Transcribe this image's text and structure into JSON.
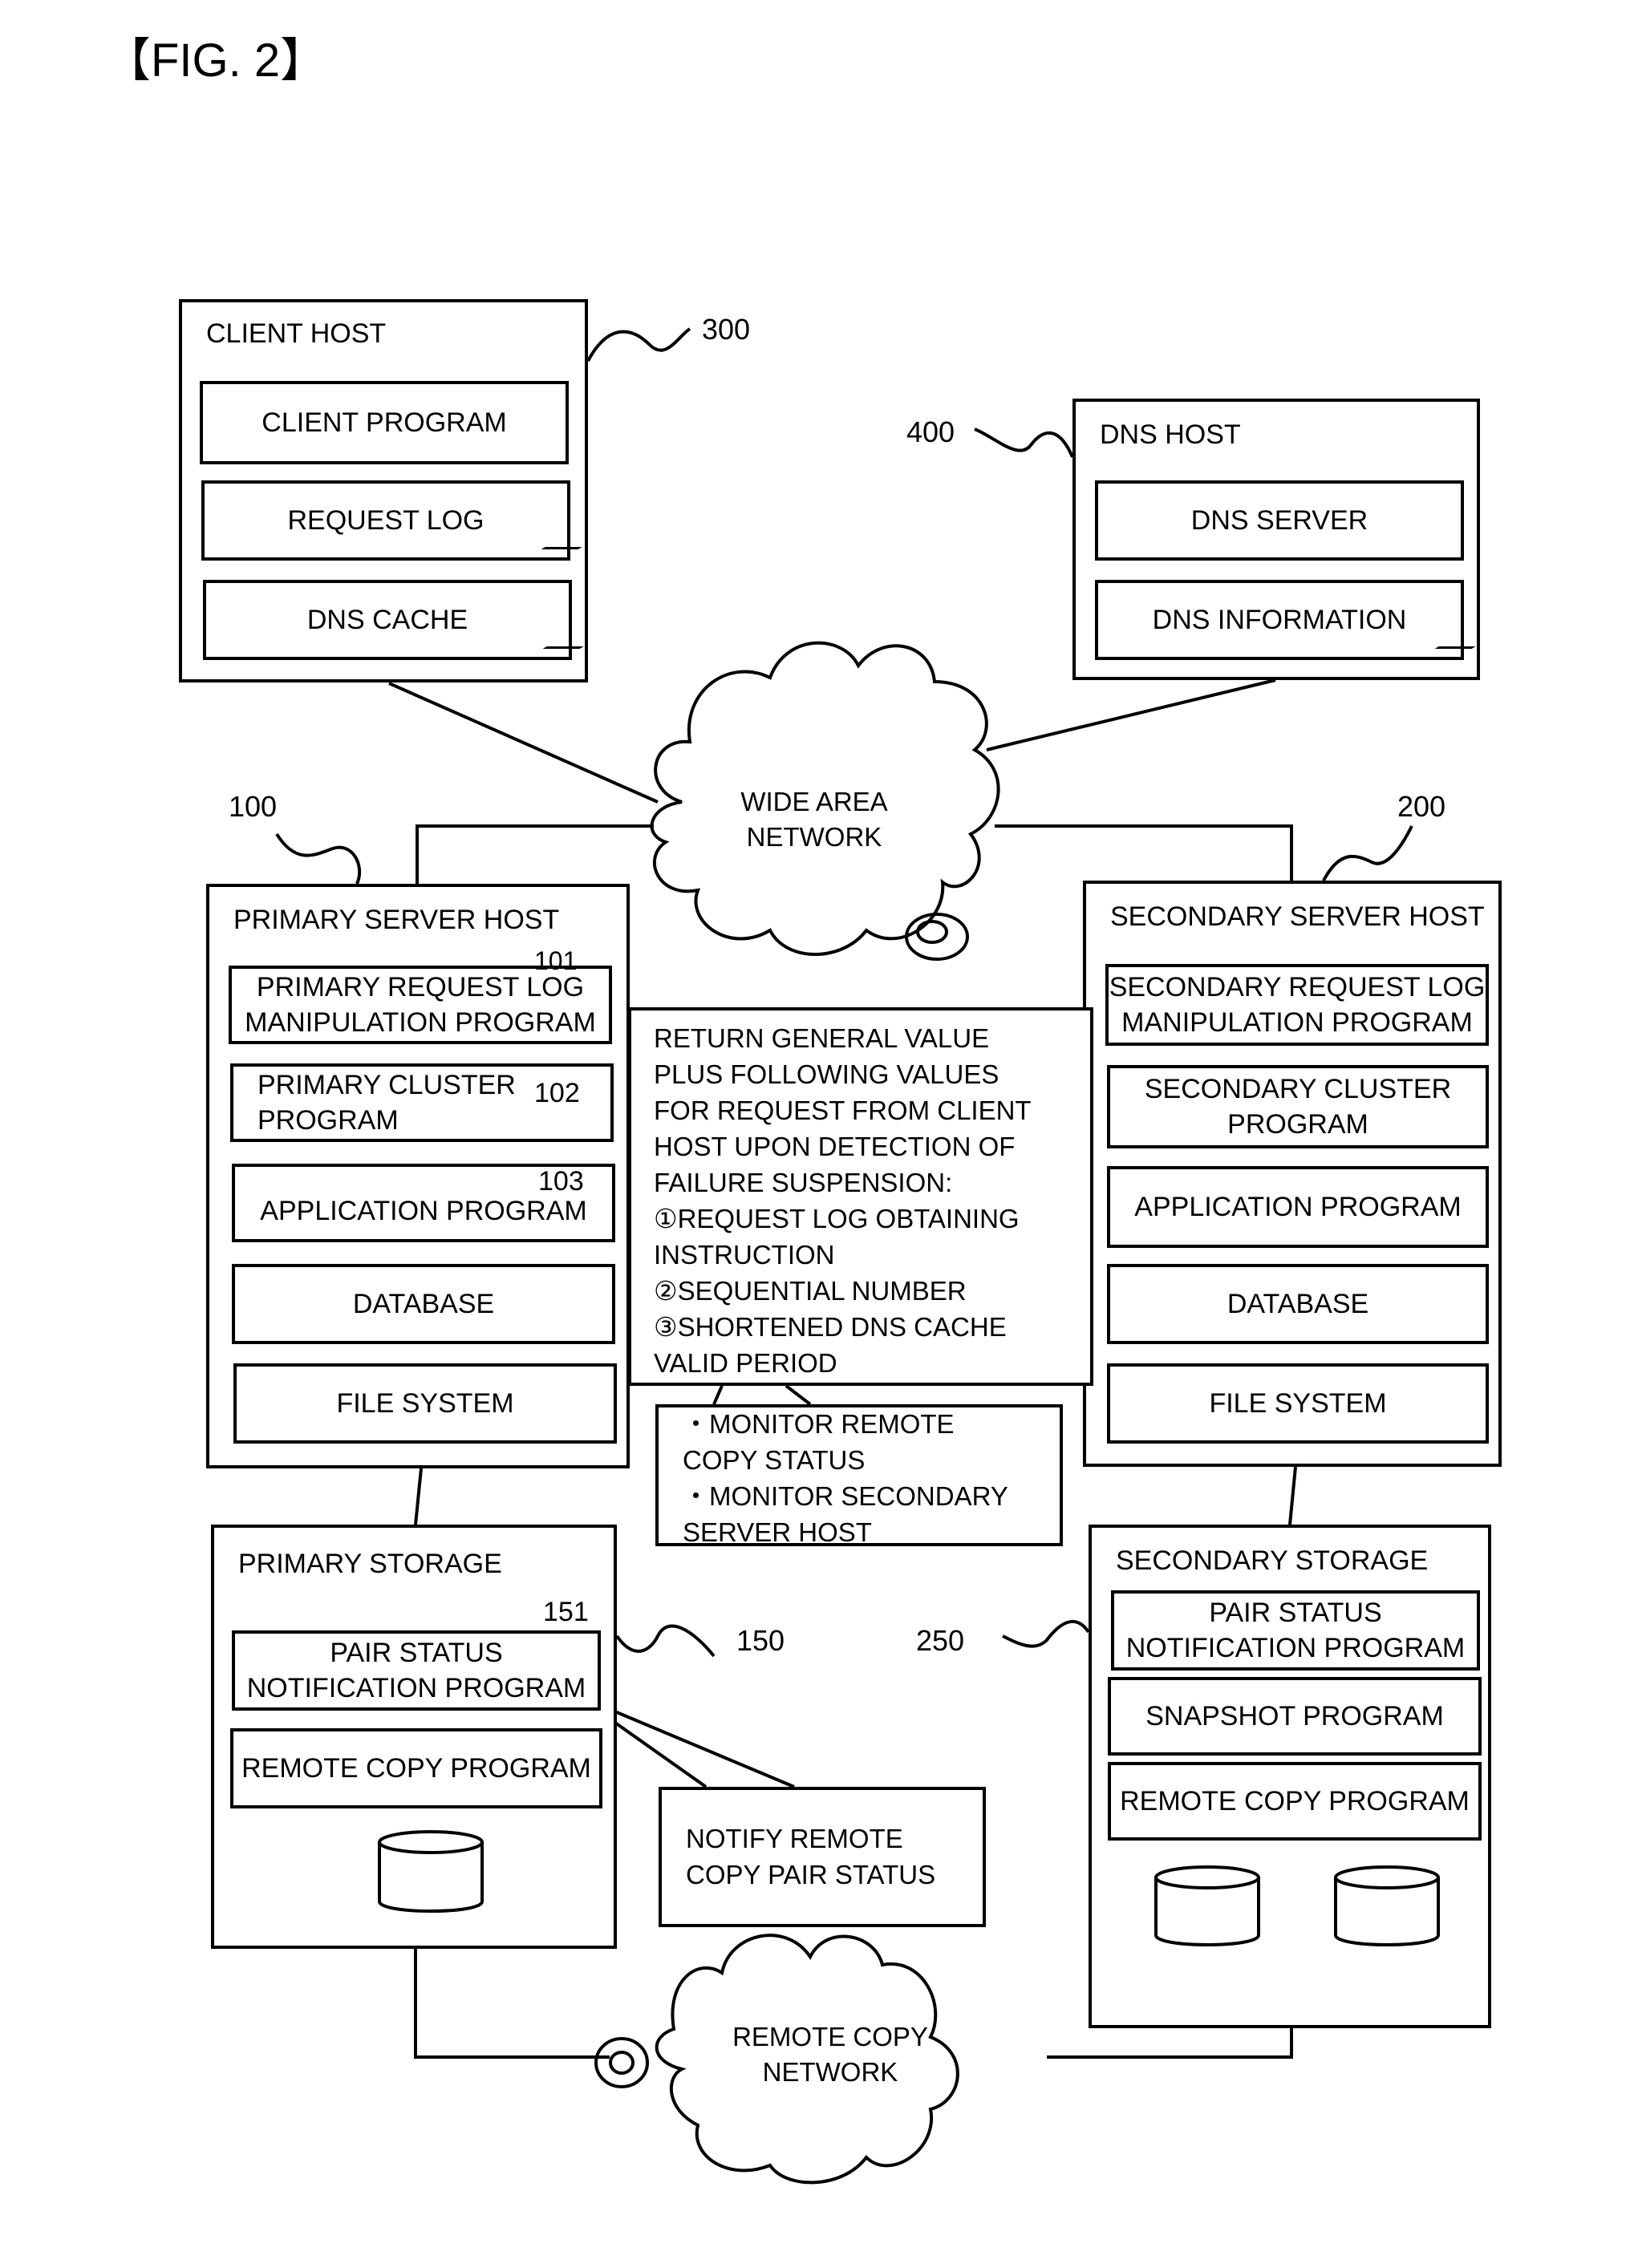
{
  "figure": {
    "label": "【FIG. 2】"
  },
  "client_host": {
    "title": "CLIENT HOST",
    "ref": "300",
    "items": [
      "CLIENT PROGRAM",
      "REQUEST LOG",
      "DNS CACHE"
    ]
  },
  "dns_host": {
    "title": "DNS HOST",
    "ref": "400",
    "items": [
      "DNS SERVER",
      "DNS INFORMATION"
    ]
  },
  "wide_area_network": {
    "label": "WIDE AREA\nNETWORK"
  },
  "primary_server_host": {
    "title": "PRIMARY SERVER HOST",
    "ref": "100",
    "items": [
      {
        "label": "PRIMARY REQUEST LOG\nMANIPULATION PROGRAM",
        "ref": "101"
      },
      {
        "label": "PRIMARY CLUSTER\nPROGRAM",
        "ref": "102"
      },
      {
        "label": "APPLICATION PROGRAM",
        "ref": "103"
      },
      {
        "label": "DATABASE"
      },
      {
        "label": "FILE SYSTEM"
      }
    ]
  },
  "secondary_server_host": {
    "title": "SECONDARY SERVER HOST",
    "ref": "200",
    "items": [
      "SECONDARY REQUEST LOG\nMANIPULATION PROGRAM",
      "SECONDARY CLUSTER\nPROGRAM",
      "APPLICATION PROGRAM",
      "DATABASE",
      "FILE SYSTEM"
    ]
  },
  "callout_return": {
    "text": "RETURN GENERAL VALUE\nPLUS FOLLOWING VALUES\nFOR REQUEST FROM CLIENT\nHOST UPON DETECTION OF\nFAILURE SUSPENSION:\n①REQUEST LOG OBTAINING\nINSTRUCTION\n②SEQUENTIAL NUMBER\n③SHORTENED DNS CACHE\nVALID PERIOD"
  },
  "callout_monitor": {
    "text": "・MONITOR REMOTE\nCOPY STATUS\n・MONITOR SECONDARY\nSERVER HOST"
  },
  "primary_storage": {
    "title": "PRIMARY STORAGE",
    "ref": "150",
    "items": [
      {
        "label": "PAIR STATUS\nNOTIFICATION PROGRAM",
        "ref": "151"
      },
      {
        "label": "REMOTE COPY PROGRAM"
      }
    ],
    "disks": 1
  },
  "secondary_storage": {
    "title": "SECONDARY STORAGE",
    "ref": "250",
    "items": [
      "PAIR STATUS\nNOTIFICATION PROGRAM",
      "SNAPSHOT PROGRAM",
      "REMOTE COPY PROGRAM"
    ],
    "disks": 2
  },
  "callout_notify": {
    "text": "NOTIFY REMOTE\nCOPY PAIR STATUS"
  },
  "remote_copy_network": {
    "label": "REMOTE COPY\nNETWORK"
  }
}
